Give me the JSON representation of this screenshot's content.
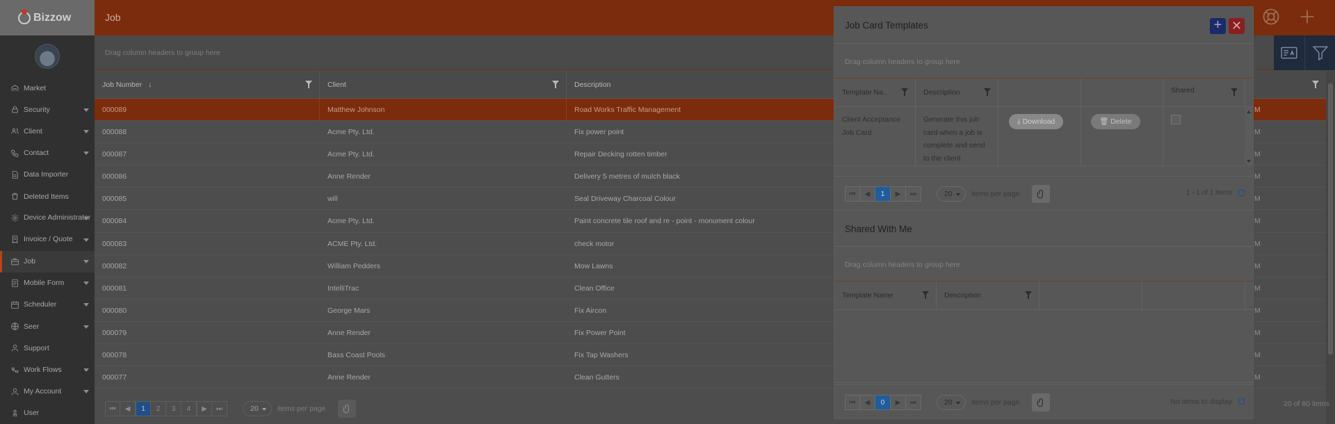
{
  "app": {
    "brand": "Bizzow",
    "page_title": "Job"
  },
  "sidebar": {
    "items": [
      {
        "label": "Market",
        "icon": "market-icon",
        "caret": false
      },
      {
        "label": "Security",
        "icon": "lock-icon",
        "caret": true
      },
      {
        "label": "Client",
        "icon": "users-icon",
        "caret": true
      },
      {
        "label": "Contact",
        "icon": "phone-icon",
        "caret": true
      },
      {
        "label": "Data Importer",
        "icon": "document-icon",
        "caret": false
      },
      {
        "label": "Deleted Items",
        "icon": "trash-icon",
        "caret": false
      },
      {
        "label": "Device Administrator",
        "icon": "gear-icon",
        "caret": true
      },
      {
        "label": "Invoice / Quote",
        "icon": "invoice-icon",
        "caret": true
      },
      {
        "label": "Job",
        "icon": "briefcase-icon",
        "caret": true,
        "active": true
      },
      {
        "label": "Mobile Form",
        "icon": "form-icon",
        "caret": true
      },
      {
        "label": "Scheduler",
        "icon": "calendar-icon",
        "caret": true
      },
      {
        "label": "Seer",
        "icon": "globe-icon",
        "caret": true
      },
      {
        "label": "Support",
        "icon": "support-icon",
        "caret": false
      },
      {
        "label": "Work Flows",
        "icon": "workflow-icon",
        "caret": true
      },
      {
        "label": "My Account",
        "icon": "account-icon",
        "caret": true
      },
      {
        "label": "User",
        "icon": "user-icon",
        "caret": false
      }
    ]
  },
  "main": {
    "group_hint": "Drag column headers to group here",
    "columns": [
      "Job Number",
      "Client",
      "Description"
    ],
    "sort_indicator": "↓",
    "rows": [
      {
        "job": "000089",
        "client": "Matthew Johnson",
        "desc": "Road Works Traffic Management",
        "selected": true
      },
      {
        "job": "000088",
        "client": "Acme Pty. Ltd.",
        "desc": "Fix power point"
      },
      {
        "job": "000087",
        "client": "Acme Pty. Ltd.",
        "desc": "Repair Decking rotten timber"
      },
      {
        "job": "000086",
        "client": "Anne Render",
        "desc": "Delivery 5 metres of mulch black"
      },
      {
        "job": "000085",
        "client": "will",
        "desc": "Seal Driveway Charcoal Colour"
      },
      {
        "job": "000084",
        "client": "Acme Pty. Ltd.",
        "desc": "Paint concrete tile roof and re - point - monument colour"
      },
      {
        "job": "000083",
        "client": "ACME Pty. Ltd.",
        "desc": "check motor"
      },
      {
        "job": "000082",
        "client": "William Pedders",
        "desc": "Mow Lawns"
      },
      {
        "job": "000081",
        "client": "IntelliTrac",
        "desc": "Clean Office"
      },
      {
        "job": "000080",
        "client": "George Mars",
        "desc": "Fix Aircon"
      },
      {
        "job": "000079",
        "client": "Anne Render",
        "desc": "Fix Power Point"
      },
      {
        "job": "000078",
        "client": "Bass Coast Pools",
        "desc": "Fix Tap Washers"
      },
      {
        "job": "000077",
        "client": "Anne Render",
        "desc": "Clean Gutters"
      }
    ],
    "right_cells": [
      "M",
      "M",
      "M",
      "M",
      "M",
      "M",
      "M",
      "M",
      "M",
      "M",
      "M",
      "M",
      "M"
    ],
    "pager": {
      "pages": [
        "1",
        "2",
        "3",
        "4"
      ],
      "current": "1",
      "per_page": "20",
      "per_page_label": "items per page",
      "info": "20 of 80 items"
    }
  },
  "modal": {
    "title": "Job Card Templates",
    "add_label": "+",
    "close_label": "✕",
    "group_hint": "Drag column headers to group here",
    "columns": [
      "Template Na...",
      "Description",
      "",
      "",
      "Shared"
    ],
    "row": {
      "name": "Client Acceptance Job Card",
      "description": "Generate this job card when a job is complete and send to the client",
      "download_label": "Download",
      "delete_label": "Delete"
    },
    "pager": {
      "current": "1",
      "per_page": "20",
      "per_page_label": "items per page",
      "info": "1 - 1 of 1 items"
    },
    "shared_title": "Shared With Me",
    "shared_group_hint": "Drag column headers to group here",
    "shared_columns": [
      "Template Name",
      "Description",
      "",
      ""
    ],
    "shared_pager": {
      "current": "0",
      "per_page": "20",
      "per_page_label": "items per page",
      "info": "No items to display"
    }
  },
  "colors": {
    "accent": "#7a2c0c",
    "primary": "#1f4f86",
    "danger": "#8a1f1f"
  }
}
